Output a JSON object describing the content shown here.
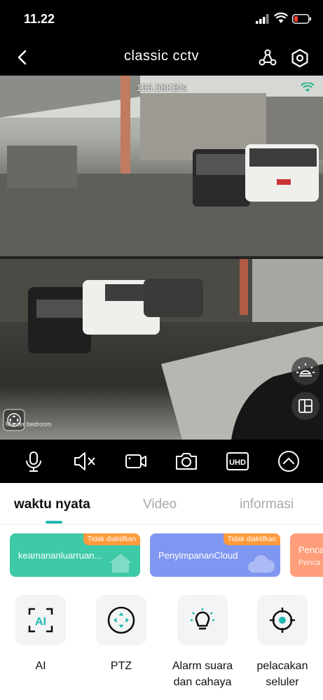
{
  "status_bar": {
    "time": "11.22"
  },
  "nav": {
    "title": "classic cctv"
  },
  "video": {
    "bitrate": "196.58KB/s",
    "camera_label": "Master bedroom"
  },
  "tabs": [
    {
      "label": "waktu nyata",
      "active": true
    },
    {
      "label": "Video",
      "active": false
    },
    {
      "label": "informasi",
      "active": false
    }
  ],
  "cards": [
    {
      "label": "keamananluarruan...",
      "badge": "Tidak diaktifkan",
      "color": "#3ec9a7"
    },
    {
      "label": "PenyimpananCloud",
      "badge": "Tidak diaktifkan",
      "color": "#7f97f0"
    },
    {
      "label": "Penca",
      "sublabel": "Penca",
      "color": "#ff9e7a"
    }
  ],
  "features": [
    {
      "label": "AI",
      "icon": "ai-icon"
    },
    {
      "label": "PTZ",
      "icon": "ptz-icon"
    },
    {
      "label": "Alarm suara dan cahaya",
      "icon": "bulb-icon"
    },
    {
      "label": "pelacakan seluler",
      "icon": "target-icon"
    }
  ],
  "colors": {
    "accent": "#1fb8b0",
    "badge": "#ff9b3d"
  }
}
